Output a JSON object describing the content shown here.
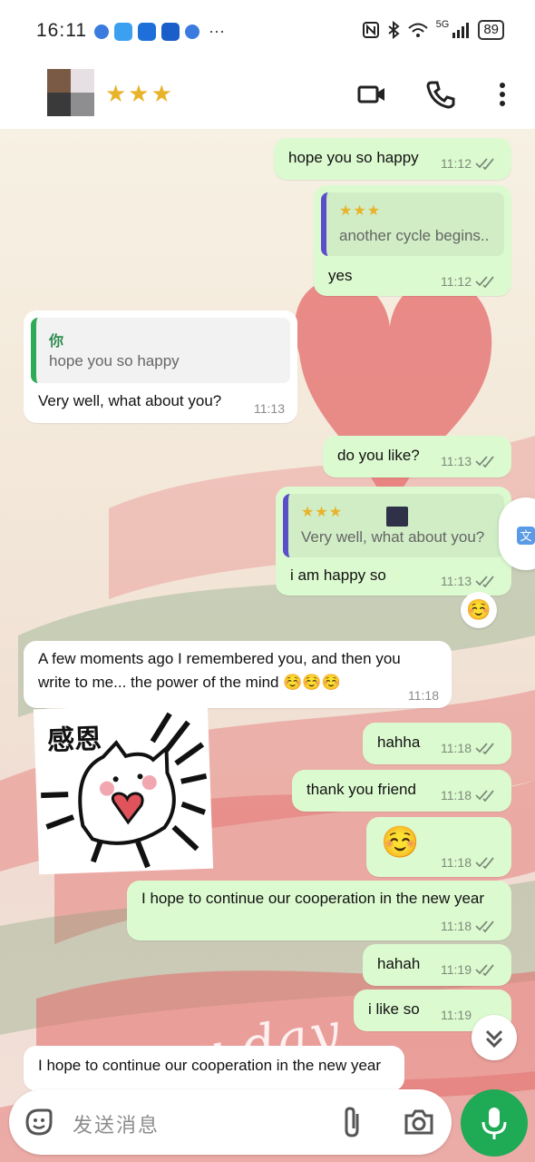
{
  "status_bar": {
    "time": "16:11",
    "more": "···",
    "network": "5G",
    "battery": "89"
  },
  "header": {
    "contact_name": "★★★",
    "video_icon": "video-camera-icon",
    "call_icon": "phone-icon",
    "menu_icon": "more-vertical-icon"
  },
  "messages": [
    {
      "dir": "out",
      "text": "hope you so happy",
      "time": "11:12"
    },
    {
      "dir": "out",
      "quote_name": "★★★",
      "quote_text": "another cycle begins..",
      "text": "yes",
      "time": "11:12"
    },
    {
      "dir": "in",
      "quote_name": "你",
      "quote_text": "hope you so happy",
      "text": "Very well, what about you?",
      "time": "11:13"
    },
    {
      "dir": "out",
      "text": "do you like?",
      "time": "11:13"
    },
    {
      "dir": "out",
      "quote_name": "★★★",
      "quote_text": "Very well, what about you?",
      "text": "i am happy so",
      "time": "11:13",
      "reaction": "☺️"
    },
    {
      "dir": "in",
      "text_line1": "A few moments ago I remembered you, and then you",
      "text_line2": "write to me... the power of the mind ☺️☺️☺️",
      "time": "11:18"
    },
    {
      "dir": "in",
      "type": "sticker",
      "sticker_text": "感恩"
    },
    {
      "dir": "out",
      "text": "hahha",
      "time": "11:18"
    },
    {
      "dir": "out",
      "text": "thank you friend",
      "time": "11:18"
    },
    {
      "dir": "out",
      "text": "☺️",
      "time": "11:18"
    },
    {
      "dir": "out",
      "text": "I hope to continue our cooperation in the new year",
      "time": "11:18"
    },
    {
      "dir": "out",
      "text": "hahah",
      "time": "11:19"
    },
    {
      "dir": "out",
      "text": "i like so",
      "time": "11:19"
    },
    {
      "dir": "in",
      "text": "I hope to continue our cooperation in the new year"
    }
  ],
  "wallpaper_text": "Happy day",
  "composer": {
    "placeholder": "发送消息",
    "emoji_icon": "sticker-icon",
    "attach_icon": "paperclip-icon",
    "camera_icon": "camera-icon",
    "mic_icon": "microphone-icon"
  },
  "colors": {
    "outgoing": "#dcfad0",
    "incoming": "#ffffff",
    "accent_green": "#1faa55",
    "quote_bar": "#5b4ec9"
  }
}
